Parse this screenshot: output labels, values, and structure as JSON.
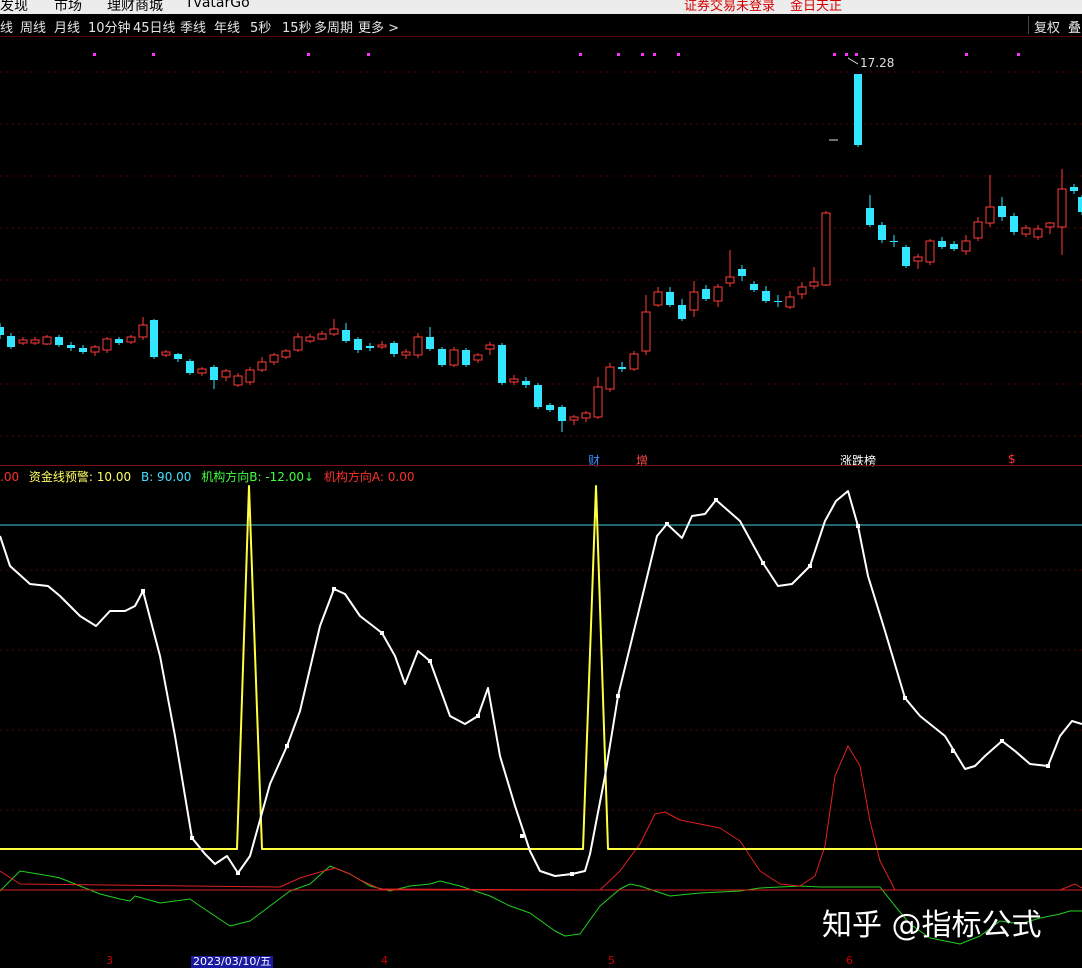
{
  "top_menu": {
    "items": [
      "发现",
      "市场",
      "理财商城",
      "TvatarGo"
    ],
    "status_login": "证券交易未登录",
    "status_news": "金日天正"
  },
  "period_bar": {
    "items": [
      "线",
      "周线",
      "月线",
      "10分钟",
      "45日线",
      "季线",
      "年线",
      "5秒",
      "15秒",
      "多周期",
      "更多 >"
    ],
    "right_buttons": [
      "复权",
      "叠"
    ]
  },
  "main_chart": {
    "max_price_label": "17.28",
    "event_labels": [
      {
        "text": "财",
        "color": "#3a8dff"
      },
      {
        "text": "增",
        "color": "#ff4a4a"
      },
      {
        "text": "涨跌榜",
        "color": "#ffffff"
      },
      {
        "text": "$",
        "color": "#ff3030"
      }
    ]
  },
  "indicator": {
    "legend": [
      {
        "text": ".00",
        "color": "#ff3030"
      },
      {
        "text": "资金线预警: 10.00",
        "color": "#ffff60"
      },
      {
        "text": "B: 90.00",
        "color": "#40e0ff"
      },
      {
        "text": "机构方向B: -12.00↓",
        "color": "#40ff40"
      },
      {
        "text": "机构方向A: 0.00",
        "color": "#ff3030"
      }
    ]
  },
  "time_axis": {
    "selected_date": "2023/03/10/五",
    "ticks": [
      "3",
      "4",
      "5",
      "6"
    ]
  },
  "watermark": "知乎 @指标公式",
  "colors": {
    "up": "#ff3c3c",
    "down": "#33e6ff",
    "white_line": "#ffffff",
    "yellow_line": "#ffff40",
    "red_line": "#e02020",
    "green_line": "#20d020",
    "cyan_line": "#40d0e0"
  }
}
